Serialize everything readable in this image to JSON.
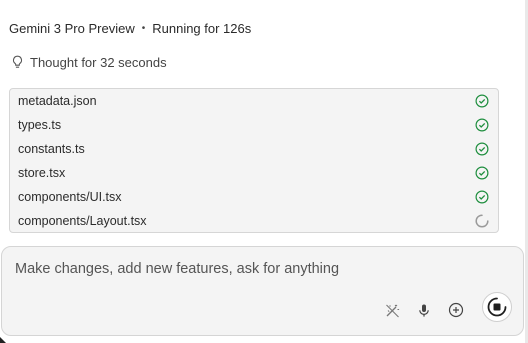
{
  "header": {
    "model": "Gemini 3 Pro Preview",
    "separator": "•",
    "status": "Running for 126s"
  },
  "thought": {
    "icon": "lightbulb-icon",
    "label": "Thought for 32 seconds"
  },
  "files": [
    {
      "name": "metadata.json",
      "state": "done"
    },
    {
      "name": "types.ts",
      "state": "done"
    },
    {
      "name": "constants.ts",
      "state": "done"
    },
    {
      "name": "store.tsx",
      "state": "done"
    },
    {
      "name": "components/UI.tsx",
      "state": "done"
    },
    {
      "name": "components/Layout.tsx",
      "state": "loading"
    }
  ],
  "composer": {
    "placeholder": "Make changes, add new features, ask for anything",
    "tools": [
      "magic-edit-icon",
      "microphone-icon",
      "add-icon"
    ],
    "stop_icon": "stop-icon"
  },
  "colors": {
    "success": "#1e8e3e",
    "spinner": "#9a9a9a"
  }
}
